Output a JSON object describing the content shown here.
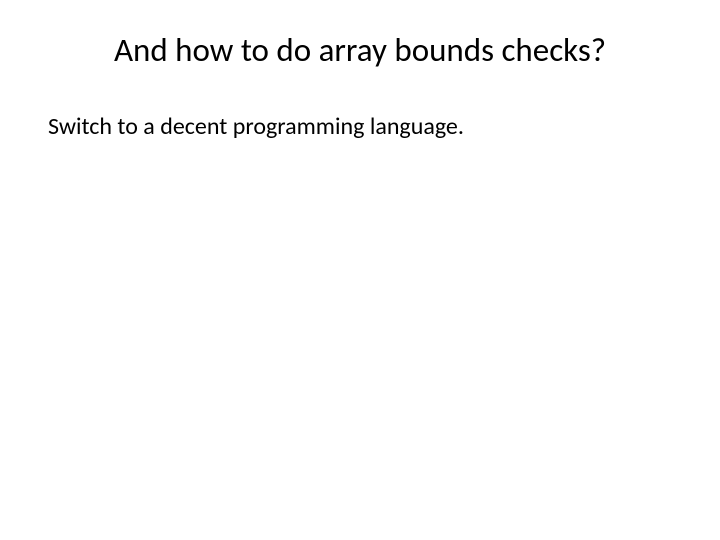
{
  "slide": {
    "title": "And how to do array bounds checks?",
    "body": "Switch to a decent programming language."
  }
}
